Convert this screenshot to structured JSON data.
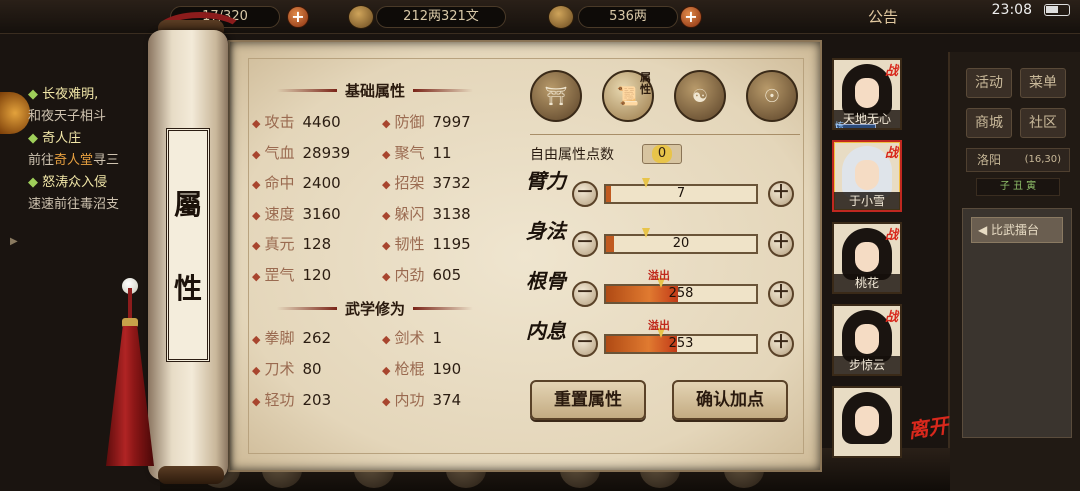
{
  "topbar": {
    "capacity": "17/320",
    "silver": "212两321文",
    "gold": "536两",
    "notice": "公告",
    "clock": "23:08"
  },
  "quests": [
    {
      "title": "长夜难明,",
      "desc": "和夜天子相斗"
    },
    {
      "title": "奇人庄",
      "desc_pre": "前往",
      "npc": "奇人堂",
      "desc_post": "寻三"
    },
    {
      "title": "怒涛众入侵",
      "desc": "速速前往毒沼支"
    }
  ],
  "side_menu": {
    "buttons": [
      "活动",
      "菜单",
      "商城",
      "社区"
    ],
    "location": "洛阳",
    "coords": "(16,30)",
    "time_slot": "子 丑 寅",
    "arena_button": "比武擂台"
  },
  "scroll": {
    "title_chars": [
      "屬",
      "性"
    ]
  },
  "basic_attributes": {
    "header": "基础属性",
    "items": [
      {
        "label": "攻击",
        "value": "4460"
      },
      {
        "label": "防御",
        "value": "7997"
      },
      {
        "label": "气血",
        "value": "28939"
      },
      {
        "label": "聚气",
        "value": "11"
      },
      {
        "label": "命中",
        "value": "2400"
      },
      {
        "label": "招架",
        "value": "3732"
      },
      {
        "label": "速度",
        "value": "3160"
      },
      {
        "label": "躲闪",
        "value": "3138"
      },
      {
        "label": "真元",
        "value": "128"
      },
      {
        "label": "韧性",
        "value": "1195"
      },
      {
        "label": "罡气",
        "value": "120"
      },
      {
        "label": "内劲",
        "value": "605"
      }
    ]
  },
  "martial_arts": {
    "header": "武学修为",
    "items": [
      {
        "label": "拳脚",
        "value": "262"
      },
      {
        "label": "剑术",
        "value": "1"
      },
      {
        "label": "刀术",
        "value": "80"
      },
      {
        "label": "枪棍",
        "value": "190"
      },
      {
        "label": "轻功",
        "value": "203"
      },
      {
        "label": "内功",
        "value": "374"
      }
    ]
  },
  "tabs": {
    "active_label": "属性",
    "icons": [
      "hat-character-icon",
      "attribute-scroll-icon",
      "bagua-icon",
      "meridian-body-icon"
    ]
  },
  "allocation": {
    "free_points_label": "自由属性点数",
    "free_points": "0",
    "minus": "－",
    "plus": "＋",
    "overflow_label": "溢出",
    "rows": [
      {
        "label": "臂力",
        "value": "7",
        "fill": 0.03,
        "overflow": false
      },
      {
        "label": "身法",
        "value": "20",
        "fill": 0.05,
        "overflow": false
      },
      {
        "label": "根骨",
        "value": "258",
        "fill": 0.48,
        "overflow": true
      },
      {
        "label": "内息",
        "value": "253",
        "fill": 0.47,
        "overflow": true
      }
    ],
    "reset_button": "重置属性",
    "confirm_button": "确认加点"
  },
  "party": {
    "battle_tag": "战",
    "level_tag": "炼",
    "leave_label": "离开",
    "members": [
      {
        "name": "天地无心",
        "in_battle": true
      },
      {
        "name": "于小雪",
        "in_battle": true
      },
      {
        "name": "桃花",
        "in_battle": true
      },
      {
        "name": "步惊云",
        "in_battle": true
      },
      {
        "name": "",
        "in_battle": false
      }
    ]
  },
  "colors": {
    "accent_red": "#c0281c",
    "paper": "#e4d6ba",
    "bar_fill": "#e07a30"
  }
}
